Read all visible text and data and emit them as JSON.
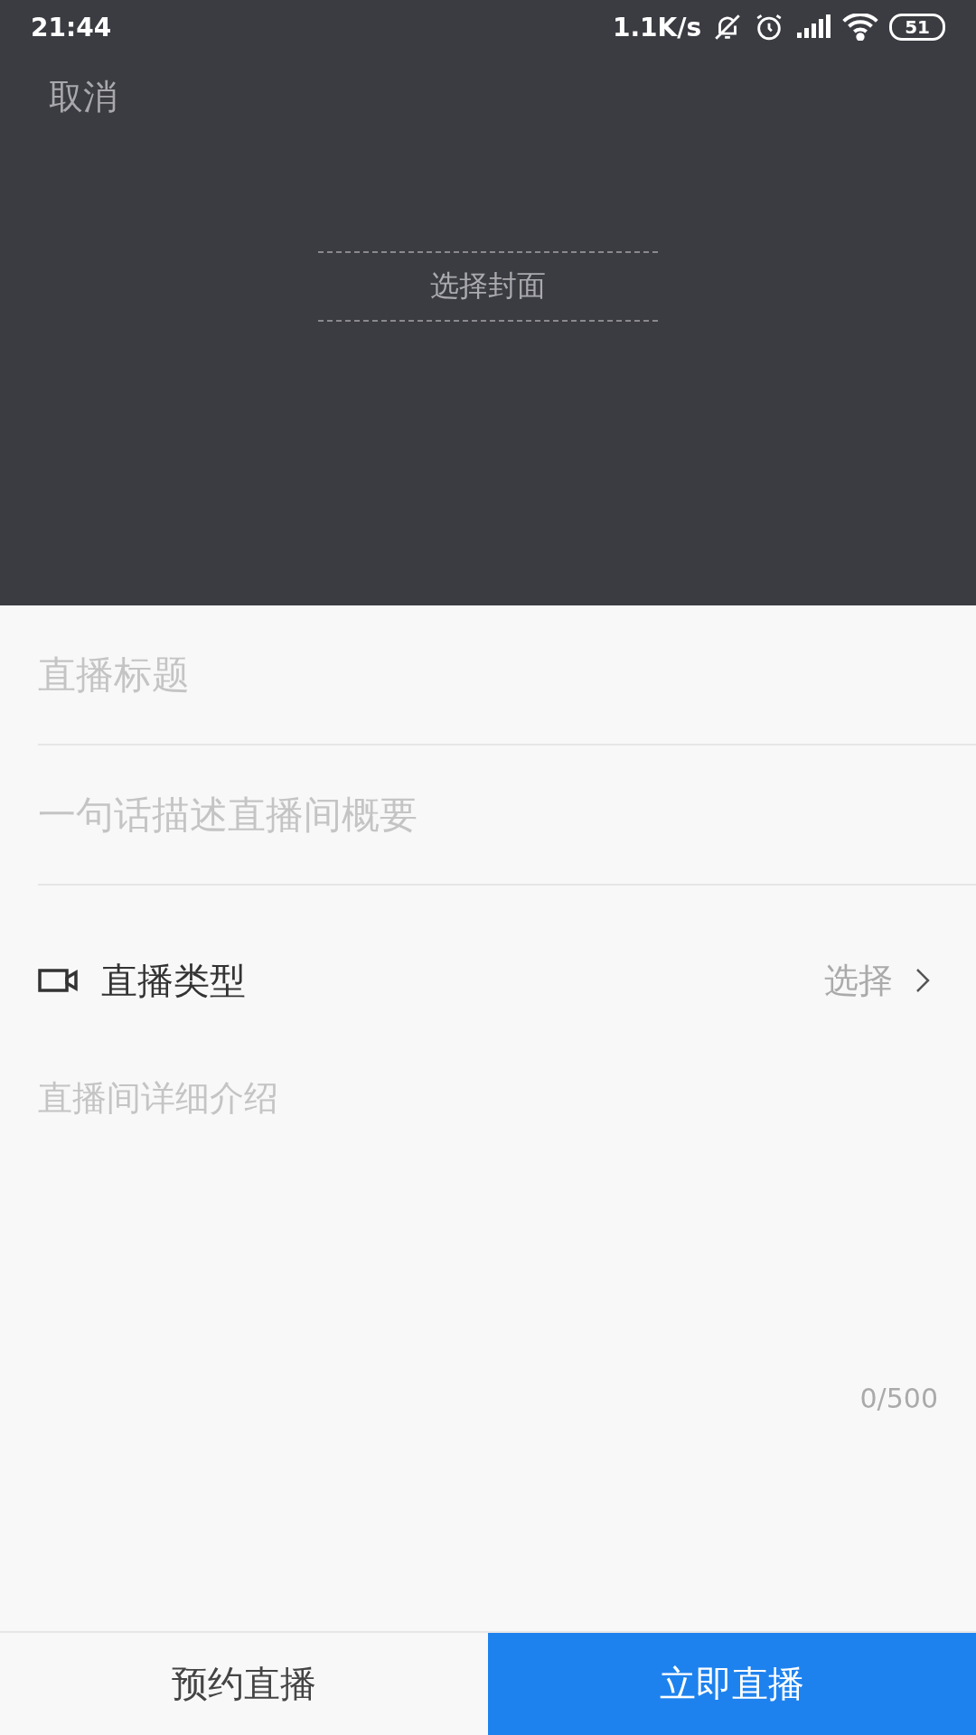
{
  "status_bar": {
    "time": "21:44",
    "network_speed": "1.1K/s",
    "battery": "51"
  },
  "header": {
    "cancel": "取消",
    "cover_label": "选择封面"
  },
  "form": {
    "title": {
      "placeholder": "直播标题"
    },
    "summary": {
      "placeholder": "一句话描述直播间概要"
    },
    "type_row": {
      "label": "直播类型",
      "value": "选择"
    },
    "detail": {
      "placeholder": "直播间详细介绍"
    },
    "counter": "0/500"
  },
  "actions": [
    {
      "label": "预约直播",
      "kind": "secondary"
    },
    {
      "label": "立即直播",
      "kind": "primary"
    }
  ]
}
